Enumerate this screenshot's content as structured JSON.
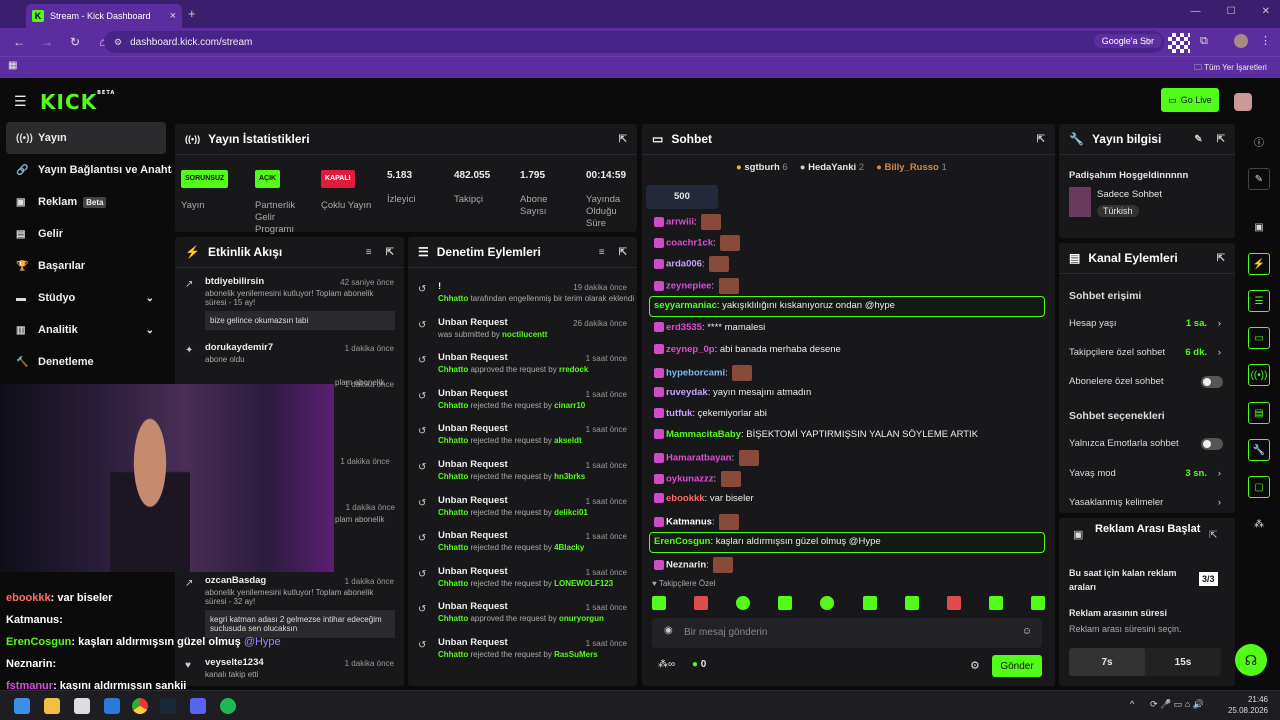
{
  "browser": {
    "tab_title": "Stream - Kick Dashboard",
    "url": "dashboard.kick.com/stream",
    "google_btn": "Google'a Sor",
    "bookmarks": "Tüm Yer İşaretleri"
  },
  "header": {
    "logo": "KICK",
    "beta": "BETA",
    "go_live": "Go Live"
  },
  "sidebar": {
    "items": [
      {
        "label": "Yayın",
        "icon": "stream-icon"
      },
      {
        "label": "Yayın Bağlantısı ve Anahtar",
        "icon": "link-icon"
      },
      {
        "label": "Reklam",
        "icon": "ad-icon",
        "badge": "Beta"
      },
      {
        "label": "Gelir",
        "icon": "revenue-icon"
      },
      {
        "label": "Başarılar",
        "icon": "trophy-icon"
      },
      {
        "label": "Stüdyo",
        "icon": "studio-icon"
      },
      {
        "label": "Analitik",
        "icon": "analytics-icon"
      },
      {
        "label": "Denetleme",
        "icon": "hammer-icon"
      }
    ]
  },
  "stats": {
    "title": "Yayın İstatistikleri",
    "items": [
      {
        "tag": "SORUNSUZ",
        "label": "Yayın",
        "color": "#53fc18"
      },
      {
        "tag": "AÇIK",
        "label": "Partnerlik Gelir Programı",
        "color": "#53fc18"
      },
      {
        "tag": "KAPALI",
        "label": "Çoklu Yayın",
        "color": "#e31b3b"
      },
      {
        "value": "5.183",
        "label": "İzleyici"
      },
      {
        "value": "482.055",
        "label": "Takipçi"
      },
      {
        "value": "1.795",
        "label": "Abone Sayısı"
      },
      {
        "value": "00:14:59",
        "label": "Yayında Olduğu Süre"
      }
    ]
  },
  "activity": {
    "title": "Etkinlik Akışı",
    "items": [
      {
        "user": "btdiyebilirsin",
        "time": "42 saniye önce",
        "text": "abonelik yenilemesini kutluyor! Toplam abonelik süresi - 15 ay!",
        "quote": "bize gelince okumazsın tabi"
      },
      {
        "user": "dorukaydemir7",
        "time": "1 dakika önce",
        "text": "abone oldu"
      },
      {
        "user": "",
        "time": "1 dakika önce",
        "text": "plam abonelik"
      },
      {
        "user": "",
        "time": "1 dakika önce",
        "text": ""
      },
      {
        "user": "",
        "time": "1 dakika önce",
        "text": "plam abonelik"
      },
      {
        "user": "ozcanBasdag",
        "time": "1 dakika önce",
        "text": "abonelik yenilemesini kutluyor! Toplam abonelik süresi - 32 ay!",
        "quote": "kegri katman adası 2 gelmezse intihar edeceğim suclusuda sen olucaksın"
      },
      {
        "user": "veyselte1234",
        "time": "1 dakika önce",
        "text": "kanalı takip etti"
      }
    ]
  },
  "moderation": {
    "title": "Denetim Eylemleri",
    "items": [
      {
        "title": "!",
        "time": "19 dakika önce",
        "actor": "Chhatto",
        "text": "tarafından engellenmiş bir terim olarak eklendi",
        "target": ""
      },
      {
        "title": "Unban Request",
        "time": "26 dakika önce",
        "actor": "",
        "text": "was submitted by",
        "target": "noctilucentt"
      },
      {
        "title": "Unban Request",
        "time": "1 saat önce",
        "actor": "Chhatto",
        "text": "approved the request by",
        "target": "rredock"
      },
      {
        "title": "Unban Request",
        "time": "1 saat önce",
        "actor": "Chhatto",
        "text": "rejected the request by",
        "target": "cinarr10"
      },
      {
        "title": "Unban Request",
        "time": "1 saat önce",
        "actor": "Chhatto",
        "text": "rejected the request by",
        "target": "akseldt"
      },
      {
        "title": "Unban Request",
        "time": "1 saat önce",
        "actor": "Chhatto",
        "text": "rejected the request by",
        "target": "hn3brks"
      },
      {
        "title": "Unban Request",
        "time": "1 saat önce",
        "actor": "Chhatto",
        "text": "rejected the request by",
        "target": "delikci01"
      },
      {
        "title": "Unban Request",
        "time": "1 saat önce",
        "actor": "Chhatto",
        "text": "rejected the request by",
        "target": "4Blacky"
      },
      {
        "title": "Unban Request",
        "time": "1 saat önce",
        "actor": "Chhatto",
        "text": "rejected the request by",
        "target": "LONEWOLF123"
      },
      {
        "title": "Unban Request",
        "time": "1 saat önce",
        "actor": "Chhatto",
        "text": "approved the request by",
        "target": "onuryorgun"
      },
      {
        "title": "Unban Request",
        "time": "1 saat önce",
        "actor": "Chhatto",
        "text": "rejected the request by",
        "target": "RasSuMers"
      }
    ]
  },
  "chat": {
    "title": "Sohbet",
    "top_gifters": [
      {
        "name": "sgtburh",
        "count": "6"
      },
      {
        "name": "HedaYanki",
        "count": "2"
      },
      {
        "name": "Billy_Russo",
        "count": "1"
      }
    ],
    "pinned_count": "500",
    "messages": [
      {
        "user": "arrwiii",
        "color": "#e04bd8",
        "text": ""
      },
      {
        "user": "coachr1ck",
        "color": "#e04bd8",
        "text": ""
      },
      {
        "user": "arda006",
        "color": "#c9a0ff",
        "text": ""
      },
      {
        "user": "zeynepiee",
        "color": "#e04bd8",
        "text": ""
      },
      {
        "user": "seyyarmaniac",
        "color": "#53fc18",
        "text": "yakışıklılığını kıskanıyoruz ondan @hype",
        "hl": true
      },
      {
        "user": "erd3535",
        "color": "#e04bd8",
        "text": "**** mamalesi"
      },
      {
        "user": "zeynep_0p",
        "color": "#e04bd8",
        "text": "abi banada merhaba desene"
      },
      {
        "user": "hypeborcami",
        "color": "#7ab8ff",
        "text": ""
      },
      {
        "user": "ruveydak",
        "color": "#c9a0ff",
        "text": "yayın mesajını atmadın"
      },
      {
        "user": "tutfuk",
        "color": "#c9a0ff",
        "text": "çekemiyorlar abi"
      },
      {
        "user": "MammacitaBaby",
        "color": "#53fc18",
        "text": "BİŞEKTOMİ YAPTIRMIŞSIN YALAN SÖYLEME ARTIK"
      },
      {
        "user": "Hamaratbayan",
        "color": "#e04bd8",
        "text": ""
      },
      {
        "user": "oykunazzz",
        "color": "#e04bd8",
        "text": ""
      },
      {
        "user": "ebookkk",
        "color": "#ff6b6b",
        "text": "var biseler"
      },
      {
        "user": "Katmanus",
        "color": "#ffffff",
        "text": ""
      },
      {
        "user": "ErenCosgun",
        "color": "#53fc18",
        "text": "kaşları aldırmışsın güzel olmuş @Hype",
        "hl": true
      },
      {
        "user": "Neznarin",
        "color": "#eeeeee",
        "text": ""
      }
    ],
    "followers_only": "Takipçilere Özel",
    "placeholder": "Bir mesaj gönderin",
    "points": "0",
    "send": "Gönder"
  },
  "info": {
    "title": "Yayın bilgisi",
    "stream_title": "Padişahım Hoşgeldinnnnn",
    "category": "Sadece Sohbet",
    "lang": "Türkish"
  },
  "channel": {
    "title": "Kanal Eylemleri",
    "chat_access": "Sohbet erişimi",
    "rows1": [
      {
        "label": "Hesap yaşı",
        "value": "1 sa."
      },
      {
        "label": "Takipçilere özel sohbet",
        "value": "6 dk."
      },
      {
        "label": "Abonelere özel sohbet",
        "value": ""
      }
    ],
    "chat_options": "Sohbet seçenekleri",
    "rows2": [
      {
        "label": "Yalnızca Emotlarla sohbet",
        "value": ""
      },
      {
        "label": "Yavaş mod",
        "value": "3 sn."
      },
      {
        "label": "Yasaklanmış kelimeler",
        "value": ""
      }
    ]
  },
  "ads": {
    "title": "Reklam Arası Başlat",
    "remaining_label": "Bu saat için kalan reklam araları",
    "remaining": "3/3",
    "duration_label": "Reklam arasının süresi",
    "duration_hint": "Reklam arası süresini seçin.",
    "opt1": "7s",
    "opt2": "15s"
  },
  "overlay_chat": [
    {
      "user": "ebookkk",
      "text": ": var biseler",
      "color": "#ff6b6b"
    },
    {
      "user": "Katmanus",
      "text": ":",
      "color": "#ffffff"
    },
    {
      "user": "ErenCosgun",
      "text": ": kaşları aldırmışsın güzel olmuş",
      "mention": "@Hype",
      "color": "#53fc18"
    },
    {
      "user": "Neznarin",
      "text": ":",
      "color": "#ffffff"
    },
    {
      "user": "fstmanur",
      "text": ": kaşını aldırmışsın sankii",
      "color": "#e04bd8"
    }
  ],
  "taskbar": {
    "time": "21:46",
    "date": "25.08.2026"
  }
}
